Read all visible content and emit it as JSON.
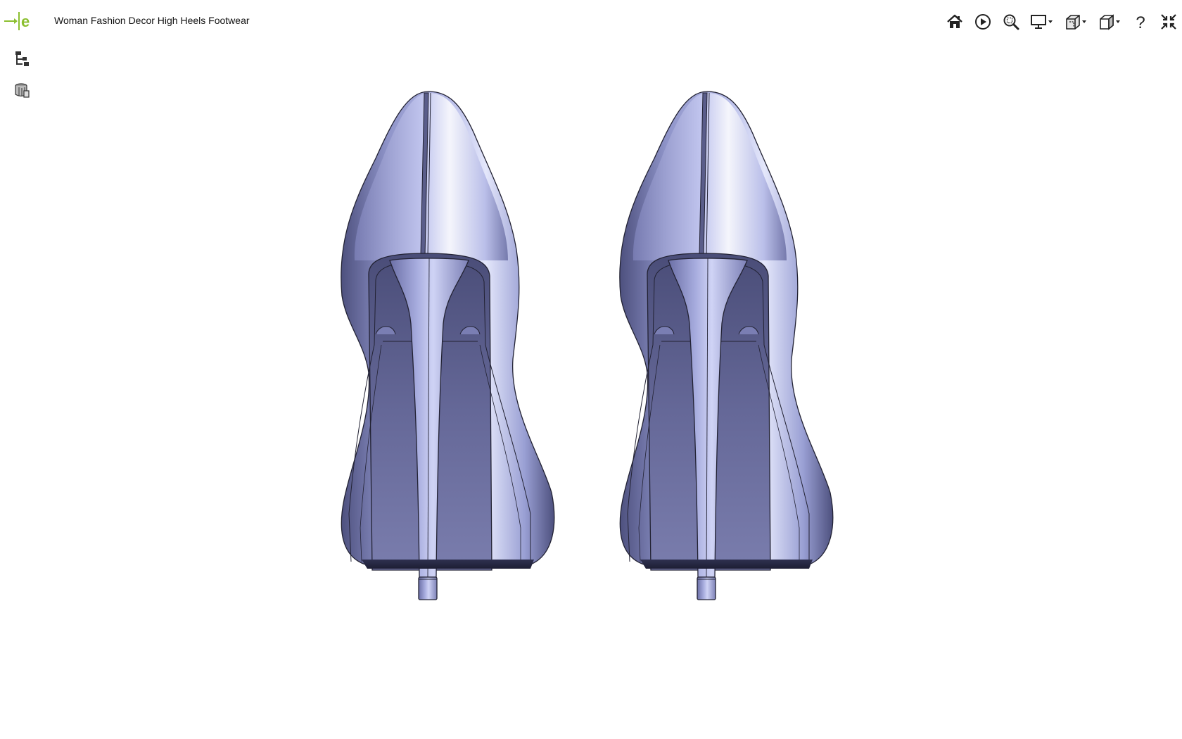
{
  "app": {
    "logo_icon": "edrawings-logo-icon",
    "title": "Woman Fashion Decor High Heels Footwear"
  },
  "side_tools": [
    {
      "icon": "component-tree-icon"
    },
    {
      "icon": "parts-stack-icon"
    }
  ],
  "toolbar": [
    {
      "icon": "home-icon"
    },
    {
      "icon": "play-animation-icon"
    },
    {
      "icon": "zoom-to-fit-icon"
    },
    {
      "icon": "display-style-icon",
      "dropdown": true
    },
    {
      "icon": "section-view-icon",
      "dropdown": true
    },
    {
      "icon": "standard-views-icon",
      "dropdown": true
    },
    {
      "icon": "help-icon"
    },
    {
      "icon": "exit-fullscreen-icon"
    }
  ],
  "model": {
    "name": "high-heels-pair",
    "colors": {
      "shell_light": "#d6daf7",
      "shell_mid": "#9aa0d4",
      "shell_dark": "#4d507e",
      "inner": "#5e6190",
      "edge": "#222233"
    }
  }
}
